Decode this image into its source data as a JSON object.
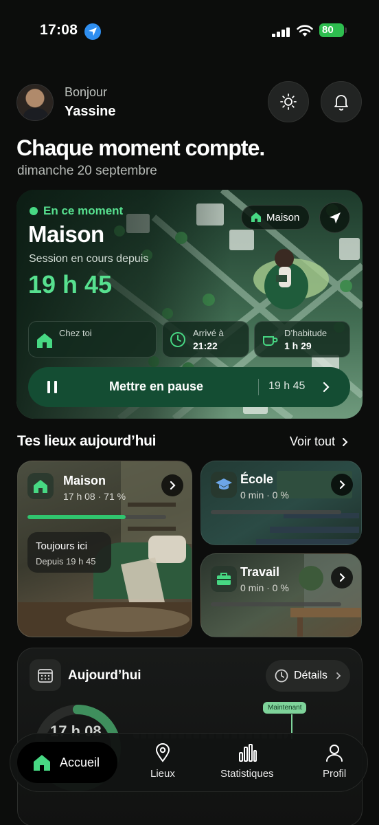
{
  "status": {
    "time": "17:08",
    "battery": "80"
  },
  "header": {
    "greeting": "Bonjour",
    "name": "Yassine",
    "headline": "Chaque moment compte.",
    "date": "dimanche 20 septembre"
  },
  "hero": {
    "now_label": "En ce moment",
    "place": "Maison",
    "session_label": "Session en cours depuis",
    "duration": "19 h 45",
    "place_chip": "Maison",
    "info": [
      {
        "label": "Chez toi",
        "value": ""
      },
      {
        "label": "Arrivé à",
        "value": "21:22"
      },
      {
        "label": "D’habitude",
        "value": "1 h 29"
      }
    ],
    "pause_label": "Mettre en pause",
    "pause_time": "19 h 45"
  },
  "places": {
    "title": "Tes lieux aujourd’hui",
    "see_all": "Voir tout",
    "items": [
      {
        "name": "Maison",
        "meta": "17 h 08 · 71 %",
        "progress": 0.71,
        "still_title": "Toujours ici",
        "still_sub": "Depuis 19 h 45"
      },
      {
        "name": "École",
        "meta": "0 min · 0 %",
        "progress": 0
      },
      {
        "name": "Travail",
        "meta": "0 min · 0 %",
        "progress": 0
      }
    ]
  },
  "today": {
    "title": "Aujourd’hui",
    "details": "Détails",
    "total": "17 h 08",
    "now_tag": "Maintenant",
    "ring_progress": 0.71
  },
  "nav": {
    "home": "Accueil",
    "places": "Lieux",
    "stats": "Statistiques",
    "profile": "Profil"
  },
  "colors": {
    "accent": "#57e08f",
    "progress": "#30c56e",
    "pause_bg": "#144d33"
  }
}
